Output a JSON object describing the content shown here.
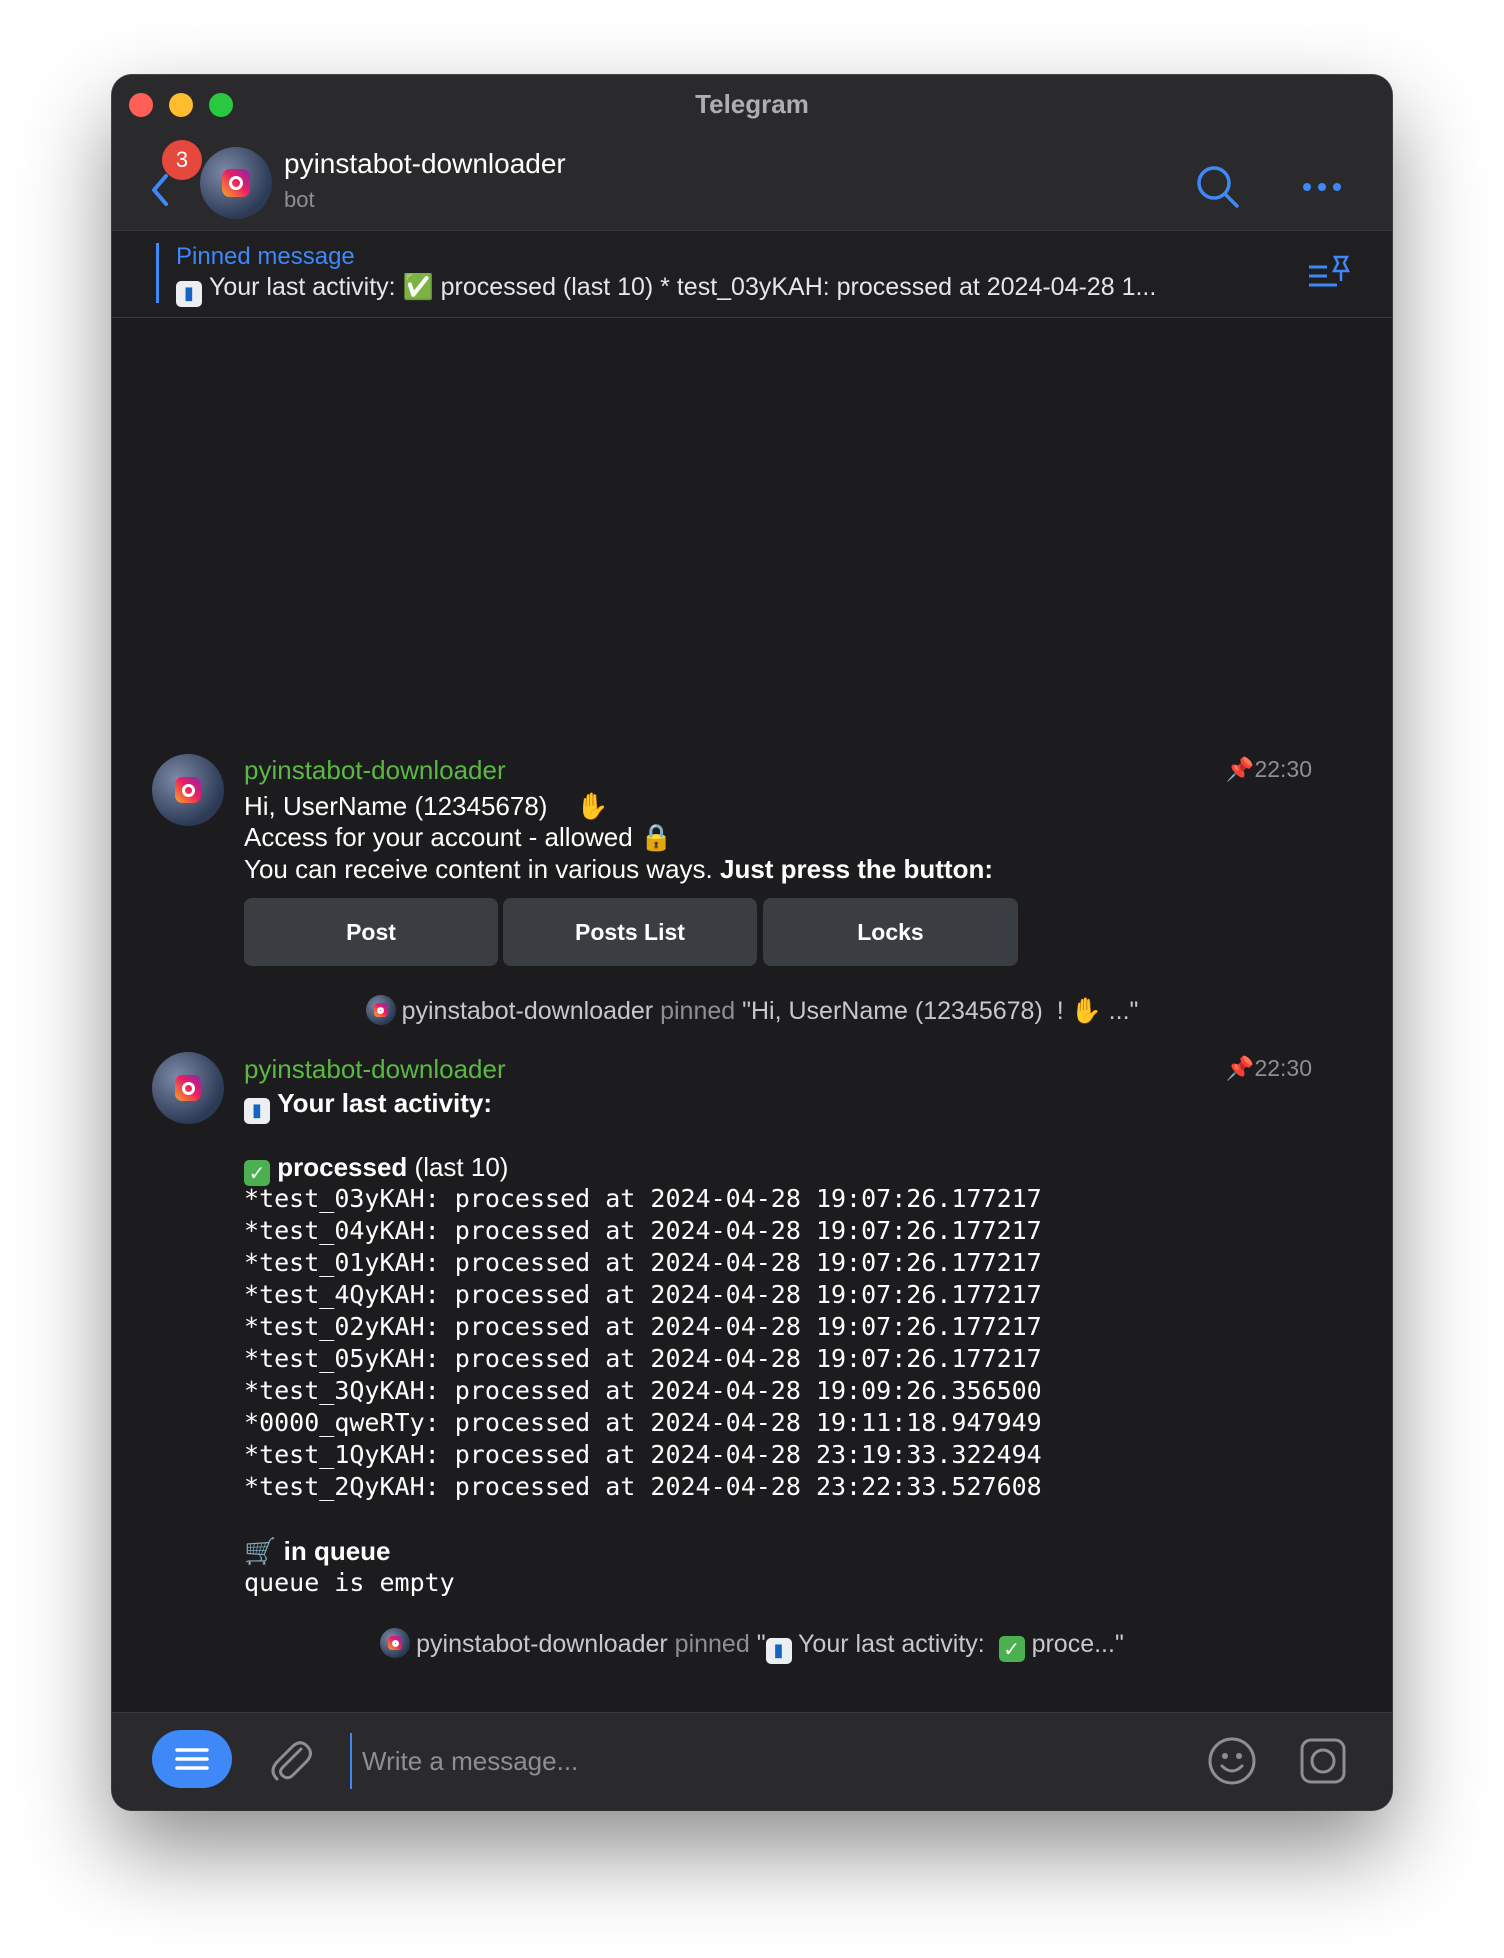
{
  "window": {
    "title": "Telegram"
  },
  "header": {
    "unread_badge": "3",
    "chat_name": "pyinstabot-downloader",
    "chat_subtitle": "bot",
    "icons": [
      "back-arrow-icon",
      "search-icon",
      "more-icon"
    ]
  },
  "pinned_bar": {
    "title": "Pinned message",
    "preview": "Your last activity:  ✅ processed (last 10) * test_03yKAH: processed at 2024-04-28 1..."
  },
  "messages": [
    {
      "sender": "pyinstabot-downloader",
      "time": "22:30",
      "greeting": "Hi, UserName (12345678)",
      "access_line": "Access for your account - allowed",
      "info_prefix": "You can receive content in various ways. ",
      "info_bold": "Just press the button:",
      "buttons": [
        "Post",
        "Posts List",
        "Locks"
      ]
    },
    {
      "sender": "pyinstabot-downloader",
      "time": "22:30",
      "heading": "Your last activity:",
      "processed_label": "processed",
      "processed_suffix": " (last 10)",
      "processed_items": [
        {
          "bullet": "*",
          "text": "test_03yKAH: processed at 2024-04-28 19:07:26.177217"
        },
        {
          "bullet": "*",
          "text": "test_04yKAH: processed at 2024-04-28 19:07:26.177217"
        },
        {
          "bullet": "*",
          "text": "test_01yKAH: processed at 2024-04-28 19:07:26.177217"
        },
        {
          "bullet": "*",
          "text": "test_4QyKAH: processed at 2024-04-28 19:07:26.177217"
        },
        {
          "bullet": "*",
          "text": "test_02yKAH: processed at 2024-04-28 19:07:26.177217"
        },
        {
          "bullet": "*",
          "text": "test_05yKAH: processed at 2024-04-28 19:07:26.177217"
        },
        {
          "bullet": "*",
          "text": "test_3QyKAH: processed at 2024-04-28 19:09:26.356500"
        },
        {
          "bullet": "*",
          "text": "0000_qweRTy: processed at 2024-04-28 19:11:18.947949"
        },
        {
          "bullet": "*",
          "text": "test_1QyKAH: processed at 2024-04-28 23:19:33.322494"
        },
        {
          "bullet": "*",
          "text": "test_2QyKAH: processed at 2024-04-28 23:22:33.527608"
        }
      ],
      "queue_label": "in queue",
      "queue_text": "queue is empty"
    }
  ],
  "service_messages": [
    {
      "name": "pyinstabot-downloader",
      "action": " pinned ",
      "quote_open": "\"Hi, UserName (12345678)",
      "quote_close": " ...\""
    },
    {
      "name": "pyinstabot-downloader",
      "action": " pinned ",
      "quote_open": "\"",
      "quote_mid": " Your last activity: ",
      "quote_close": " proce...\""
    }
  ],
  "input": {
    "placeholder": "Write a message...",
    "icons": [
      "menu-icon",
      "paperclip-icon",
      "emoji-icon",
      "camera-icon"
    ]
  },
  "colors": {
    "accent": "#3e88f7",
    "sender_name": "#5bb842",
    "badge": "#e5483d",
    "window_bg": "#1c1c1e",
    "inline_button": "#3a3d42"
  }
}
